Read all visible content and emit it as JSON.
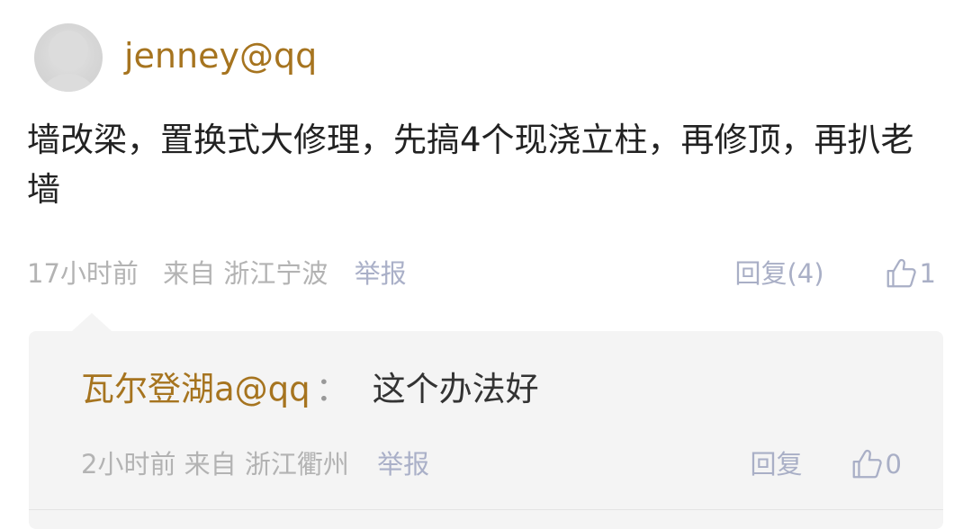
{
  "comment": {
    "username": "jenney@qq",
    "text": "墙改梁，置换式大修理，先搞4个现浇立柱，再修顶，再扒老墙",
    "time": "17小时前",
    "source": "来自 浙江宁波",
    "report_label": "举报",
    "reply_label": "回复(4)",
    "like_count": "1"
  },
  "reply": {
    "author": "瓦尔登湖a@qq",
    "separator": "：",
    "text": "这个办法好",
    "time": "2小时前",
    "source": "来自 浙江衢州",
    "report_label": "举报",
    "reply_label": "回复",
    "like_count": "0"
  },
  "colors": {
    "username": "#a6741f",
    "meta": "#b3b3b3",
    "action": "#a9afc6",
    "reply_bg": "#f4f4f4"
  },
  "icons": {
    "avatar": "default-user-avatar",
    "like": "thumbs-up-outline-icon"
  }
}
